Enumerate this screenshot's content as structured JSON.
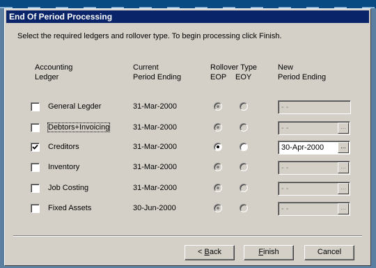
{
  "dialog": {
    "title": "End Of Period Processing",
    "instruction": "Select the required ledgers and rollover type. To begin processing click Finish."
  },
  "headers": {
    "ledger_line1": "Accounting",
    "ledger_line2": "Ledger",
    "current_line1": "Current",
    "current_line2": "Period Ending",
    "rollover_line1": "Rollover Type",
    "eop": "EOP",
    "eoy": "EOY",
    "new_line1": "New",
    "new_line2": "Period Ending"
  },
  "ledgers": [
    {
      "label": "General Legder",
      "checked": false,
      "current": "31-Mar-2000",
      "new_value": "- -",
      "enabled": false,
      "has_ellipsis": false
    },
    {
      "label": "Debtors+Invoicing",
      "checked": false,
      "current": "31-Mar-2000",
      "new_value": "- -",
      "enabled": false,
      "has_ellipsis": true
    },
    {
      "label": "Creditors",
      "checked": true,
      "current": "31-Mar-2000",
      "new_value": "30-Apr-2000",
      "enabled": true,
      "has_ellipsis": true
    },
    {
      "label": "Inventory",
      "checked": false,
      "current": "31-Mar-2000",
      "new_value": "- -",
      "enabled": false,
      "has_ellipsis": true
    },
    {
      "label": "Job Costing",
      "checked": false,
      "current": "31-Mar-2000",
      "new_value": "- -",
      "enabled": false,
      "has_ellipsis": true
    },
    {
      "label": "Fixed Assets",
      "checked": false,
      "current": "30-Jun-2000",
      "new_value": "- -",
      "enabled": false,
      "has_ellipsis": true
    }
  ],
  "ellipsis_label": "...",
  "buttons": {
    "back_prefix": "< ",
    "back_mnemonic": "B",
    "back_rest": "ack",
    "finish_mnemonic": "F",
    "finish_rest": "inish",
    "cancel": "Cancel"
  },
  "colors": {
    "titlebar": "#0a246a",
    "face": "#d4d0c8"
  }
}
